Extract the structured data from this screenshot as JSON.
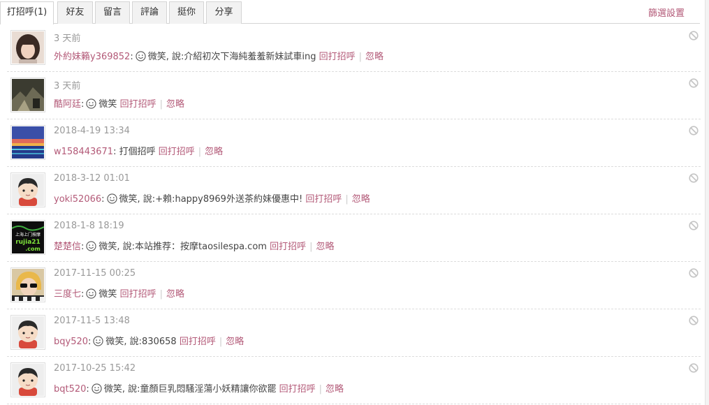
{
  "tabs": [
    "打招呼(1)",
    "好友",
    "留言",
    "評論",
    "挺你",
    "分享"
  ],
  "filter_label": "篩選設置",
  "action_reply": "回打招呼",
  "action_ignore": "忽略",
  "separator": "|",
  "colors": {
    "accent": "#b35a78",
    "muted": "#999999",
    "border": "#d4d4d4"
  },
  "items": [
    {
      "time": "3 天前",
      "user": "外約妹籟y369852",
      "message": "微笑, 說:介紹初次下海純羞羞新妹試車ing",
      "avatar": "photo-girl"
    },
    {
      "time": "3 天前",
      "user": "酷阿廷",
      "message": "微笑",
      "avatar": "photo-dark-scene"
    },
    {
      "time": "2018-4-19 13:34",
      "user": "w158443671",
      "message": "打個招呼",
      "avatar": "photo-sunset"
    },
    {
      "time": "2018-3-12 01:01",
      "user": "yoki52066",
      "message": "微笑, 說:+賴:happy8969外送茶約妹優惠中!",
      "avatar": "default-avatar"
    },
    {
      "time": "2018-1-8 18:19",
      "user": "楚楚信",
      "message": "微笑, 說:本站推荐：按摩taosilespa.com",
      "avatar": "ad-banner",
      "avatar_text_1": "上海上门按摩",
      "avatar_text_2": "rujia21",
      "avatar_text_3": ".com"
    },
    {
      "time": "2017-11-15 00:25",
      "user": "三度七",
      "message": "微笑",
      "avatar": "photo-sunglasses"
    },
    {
      "time": "2017-11-5 13:48",
      "user": "bqy520",
      "message": "微笑, 說:830658",
      "avatar": "default-avatar"
    },
    {
      "time": "2017-10-25 15:42",
      "user": "bqt520",
      "message": "微笑, 說:童顏巨乳悶騷淫蕩小妖精讓你欲罷",
      "avatar": "default-avatar"
    }
  ]
}
